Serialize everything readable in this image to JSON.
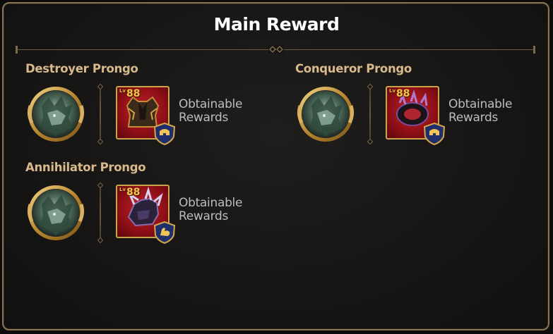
{
  "dialog": {
    "title": "Main Reward",
    "colors": {
      "border": "#8a7553",
      "name": "#d8b98a",
      "level": "#f2c64a"
    }
  },
  "bosses": [
    {
      "name": "Destroyer Prongo",
      "level_prefix": "Lv",
      "level": "88",
      "reward_line1": "Obtainable",
      "reward_line2": "Rewards",
      "item_icon": "armor-icon",
      "badge_icon": "helmet-badge-icon"
    },
    {
      "name": "Conqueror Prongo",
      "level_prefix": "Lv",
      "level": "88",
      "reward_line1": "Obtainable",
      "reward_line2": "Rewards",
      "item_icon": "bracer-icon",
      "badge_icon": "helmet-badge-icon"
    },
    {
      "name": "Annihilator Prongo",
      "level_prefix": "Lv",
      "level": "88",
      "reward_line1": "Obtainable",
      "reward_line2": "Rewards",
      "item_icon": "gauntlet-icon",
      "badge_icon": "arm-badge-icon"
    }
  ]
}
